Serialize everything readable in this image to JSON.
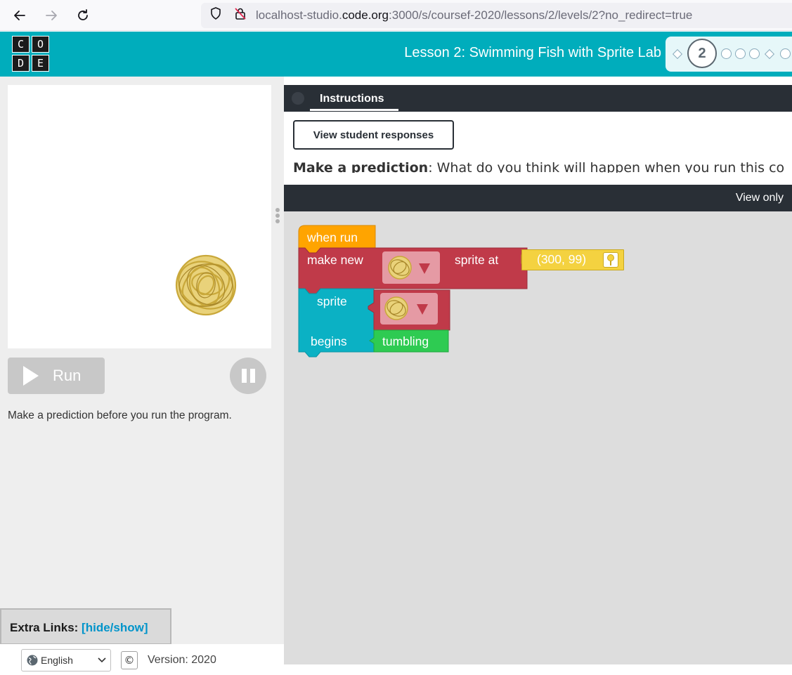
{
  "browser": {
    "url_prefix": "localhost-studio.",
    "url_domain": "code.org",
    "url_path": ":3000/s/coursef-2020/lessons/2/levels/2?no_redirect=true"
  },
  "header": {
    "logo_letters": [
      "C",
      "O",
      "D",
      "E"
    ],
    "lesson_title": "Lesson 2: Swimming Fish with Sprite Lab",
    "current_level": "2",
    "colors": {
      "teal": "#00adbc",
      "dark": "#292f36"
    }
  },
  "controls": {
    "run_label": "Run",
    "prediction_note": "Make a prediction before you run the program."
  },
  "instructions": {
    "tab_label": "Instructions",
    "view_responses_label": "View student responses",
    "bold_lead": "Make a prediction",
    "text": ": What do you think will happen when you run this co"
  },
  "workspace": {
    "header_label": "View only",
    "blocks": {
      "event": "when run",
      "make_new": "make new",
      "sprite_at": "sprite at",
      "location": "(300, 99)",
      "sprite": "sprite",
      "begins": "begins",
      "behavior": "tumbling"
    }
  },
  "footer": {
    "extra_links_label": "Extra Links: ",
    "hide_show": "[hide/show]",
    "language": "English",
    "copyright_symbol": "©",
    "version": "Version: 2020"
  }
}
